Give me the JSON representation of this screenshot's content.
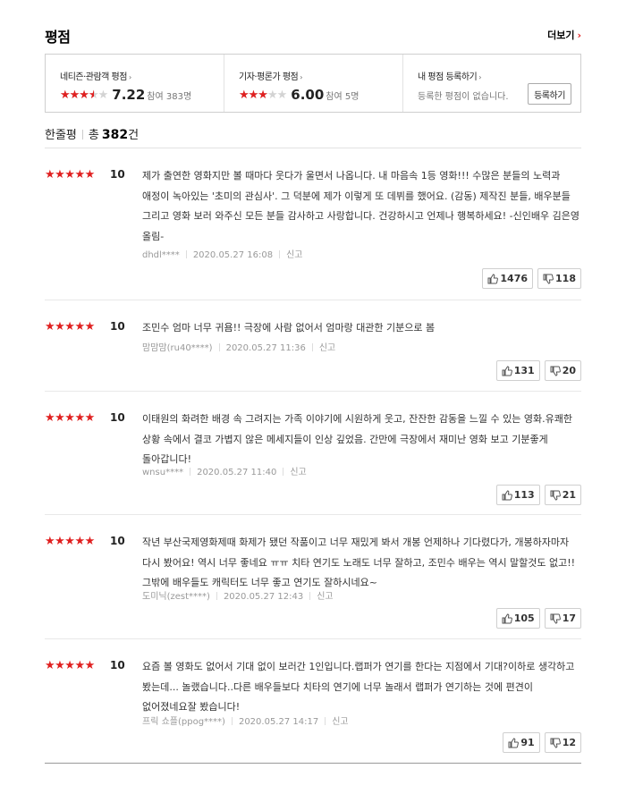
{
  "header": {
    "title": "평점",
    "more_label": "더보기",
    "more_arrow": "›"
  },
  "summary": {
    "audience": {
      "label": "네티즌·관람객 평점",
      "rating": 7.22,
      "score": "7.22",
      "participants": "참여 383명",
      "stars": "★★★★★"
    },
    "critics": {
      "label": "기자·평론가 평점",
      "rating": 6.0,
      "score": "6.00",
      "participants": "참여 5명",
      "stars": "★★★★★"
    },
    "mine": {
      "label": "내 평점 등록하기",
      "desc": "등록한 평점이 없습니다.",
      "button": "등록하기"
    },
    "caret": "›"
  },
  "count": {
    "title": "한줄평",
    "label": "총",
    "number": "382",
    "unit": "건"
  },
  "reviews": [
    {
      "stars": "★★★★★",
      "score": "10",
      "text": "제가 출연한 영화지만 볼 때마다 웃다가 울면서 나옵니다. 내 마음속 1등 영화!!! 수많은 분들의 노력과 애정이 녹아있는 '초미의 관심사'. 그 덕분에 제가 이렇게 또 데뷔를 했어요. (감동) 제작진 분들, 배우분들 그리고 영화 보러 와주신 모든 분들 감사하고 사랑합니다. 건강하시고 언제나 행복하세요! -신인배우 김은영 올림-",
      "user": "dhdl****",
      "date": "2020.05.27 16:08",
      "report": "신고",
      "likes": "1476",
      "dislikes": "118"
    },
    {
      "stars": "★★★★★",
      "score": "10",
      "text": "조민수 엄마 너무 귀욤!! 극장에 사람 없어서 엄마랑 대관한 기분으로 봄",
      "user": "맘맘맘(ru40****)",
      "date": "2020.05.27 11:36",
      "report": "신고",
      "likes": "131",
      "dislikes": "20"
    },
    {
      "stars": "★★★★★",
      "score": "10",
      "text": "이태원의 화려한 배경 속 그려지는 가족 이야기에 시원하게 웃고, 잔잔한 감동을 느낄 수 있는 영화.유쾌한 상황 속에서 결코 가볍지 않은 메세지들이 인상 깊었음. 간만에 극장에서 재미난 영화 보고 기분좋게 돌아갑니다!",
      "user": "wnsu****",
      "date": "2020.05.27 11:40",
      "report": "신고",
      "likes": "113",
      "dislikes": "21"
    },
    {
      "stars": "★★★★★",
      "score": "10",
      "text": "작년 부산국제영화제때 화제가 됐던 작품이고 너무 재밌게 봐서 개봉 언제하나 기다렸다가, 개봉하자마자 다시 봤어요! 역시 너무 좋네요 ㅠㅠ 치타 연기도 노래도 너무 잘하고, 조민수 배우는 역시 말할것도 없고!! 그밖에 배우들도 캐릭터도 너무 좋고 연기도 잘하시네요~",
      "user": "도미닉(zest****)",
      "date": "2020.05.27 12:43",
      "report": "신고",
      "likes": "105",
      "dislikes": "17"
    },
    {
      "stars": "★★★★★",
      "score": "10",
      "text": "요즘 볼 영화도 없어서 기대 없이 보러간 1인입니다.랩퍼가 연기를 한다는 지점에서 기대?이하로 생각하고 봤는데... 놀랬습니다..다른 배우들보다 치타의 연기에 너무 놀래서 랩퍼가 연기하는 것에 편견이 없어졌네요잘 봤습니다!",
      "user": "프릭 쇼플(ppog****)",
      "date": "2020.05.27 14:17",
      "report": "신고",
      "likes": "91",
      "dislikes": "12"
    }
  ]
}
